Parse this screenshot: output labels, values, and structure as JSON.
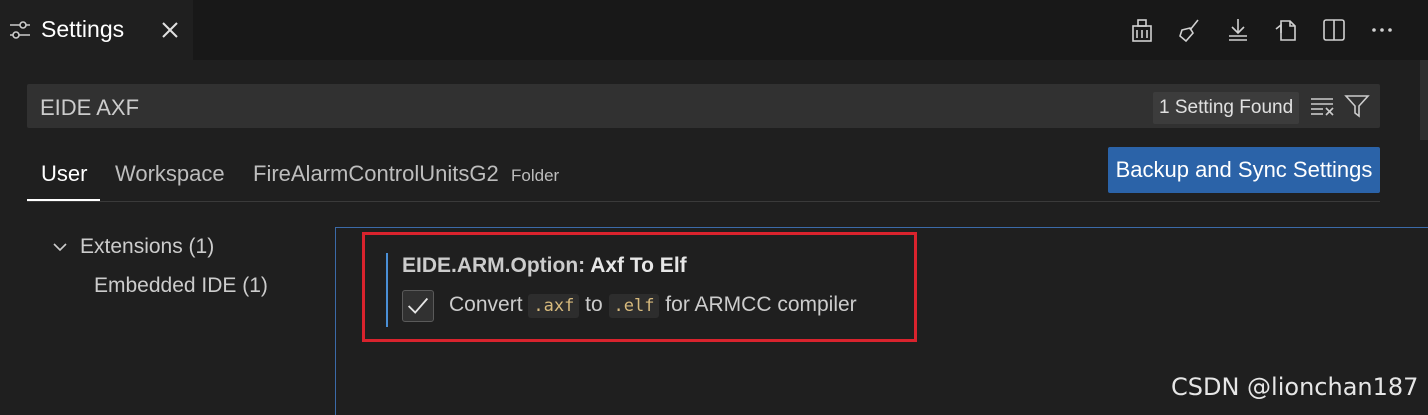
{
  "tab": {
    "title": "Settings",
    "icon": "settings-sliders-icon",
    "close": "close-icon"
  },
  "toolbar": {
    "icons": [
      "configure-icon",
      "clear-icon",
      "download-icon",
      "open-json-icon",
      "split-editor-icon",
      "more-actions-icon"
    ],
    "more_label": "···"
  },
  "search": {
    "query": "EIDE AXF",
    "result_count": "1 Setting Found"
  },
  "scopes": {
    "user": "User",
    "workspace": "Workspace",
    "folder": "FireAlarmControlUnitsG2",
    "folder_tag": "Folder"
  },
  "sync_button": "Backup and Sync Settings",
  "tree": {
    "extensions": "Extensions (1)",
    "embedded_ide": "Embedded IDE (1)"
  },
  "setting": {
    "category": "EIDE.ARM.Option: ",
    "name": "Axf To Elf",
    "checked": true,
    "desc_prefix": "Convert ",
    "code1": ".axf",
    "desc_mid": " to ",
    "code2": ".elf",
    "desc_suffix": " for ARMCC compiler"
  },
  "watermark": "CSDN @lionchan187",
  "colors": {
    "accent": "#2b63a8",
    "highlight": "#d9232d",
    "background": "#1f1f1f"
  }
}
